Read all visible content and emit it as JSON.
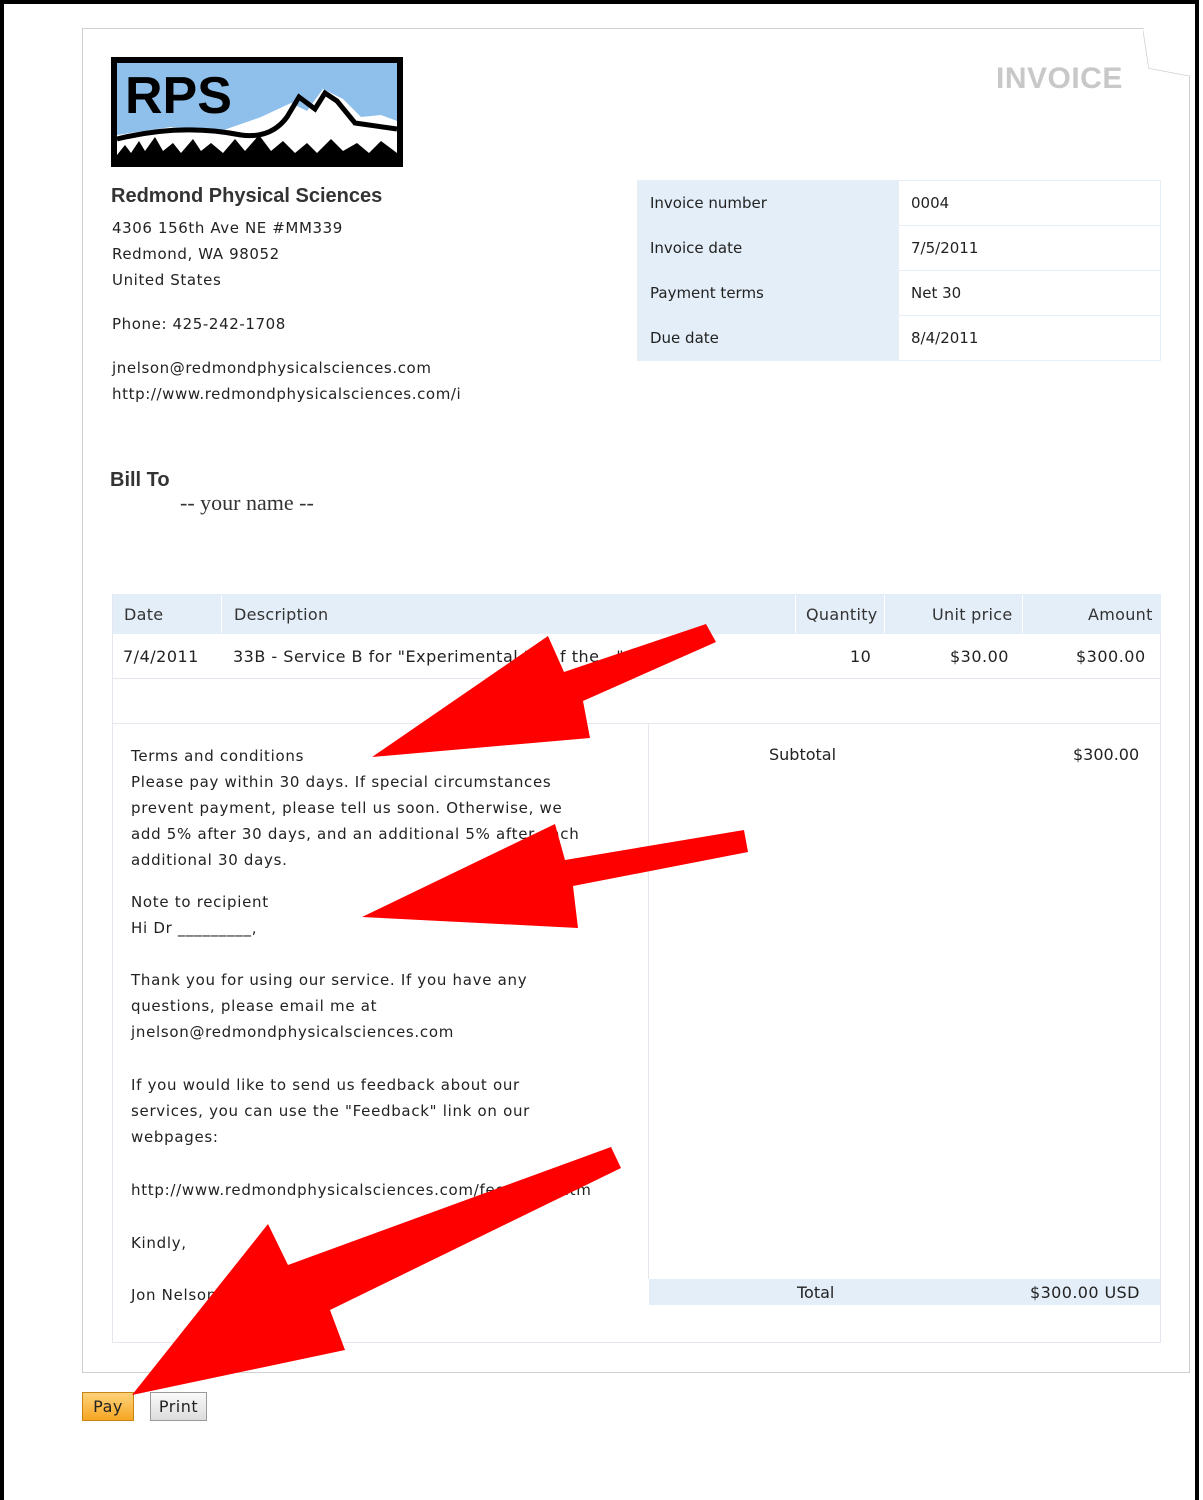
{
  "header": {
    "doc_title": "INVOICE"
  },
  "company": {
    "logo_text": "RPS",
    "name": "Redmond Physical Sciences",
    "address_line1": "4306 156th Ave NE #MM339",
    "address_line2": "Redmond, WA 98052",
    "country": "United States",
    "phone": "Phone: 425-242-1708",
    "email": "jnelson@redmondphysicalsciences.com",
    "website": "http://www.redmondphysicalsciences.com/i"
  },
  "meta": {
    "invoice_number_label": "Invoice number",
    "invoice_number": "0004",
    "invoice_date_label": "Invoice date",
    "invoice_date": "7/5/2011",
    "payment_terms_label": "Payment terms",
    "payment_terms": "Net 30",
    "due_date_label": "Due date",
    "due_date": "8/4/2011"
  },
  "bill_to": {
    "label": "Bill To",
    "name": "-- your name --"
  },
  "items": {
    "headers": {
      "date": "Date",
      "description": "Description",
      "quantity": "Quantity",
      "unit_price": "Unit price",
      "amount": "Amount"
    },
    "rows": [
      {
        "date": "7/4/2011",
        "description": "33B - Service B for \"Experimental t",
        "description_tail": "f the...\"",
        "quantity": "10",
        "unit_price": "$30.00",
        "amount": "$300.00"
      }
    ]
  },
  "terms": {
    "heading": "Terms and conditions",
    "lines": [
      "Please pay within 30 days. If special circumstances",
      "prevent payment, please tell us soon. Otherwise, we",
      "add 5% after 30 days, and an additional 5% after each",
      "additional 30 days."
    ],
    "note_heading": "Note to recipient",
    "note_greeting": "Hi Dr _________,",
    "thanks_lines": [
      "Thank you for using our service. If you have any",
      "questions, please email me at",
      "jnelson@redmondphysicalsciences.com"
    ],
    "feedback_lines": [
      "If you would like to send us feedback about our",
      "services, you can use the \"Feedback\" link on our",
      "webpages:"
    ],
    "feedback_url": "http://www.redmondphysicalsciences.com/feedback.htm",
    "closing": "Kindly,",
    "signature": "Jon Nelson"
  },
  "totals": {
    "subtotal_label": "Subtotal",
    "subtotal": "$300.00",
    "total_label": "Total",
    "total": "$300.00 USD"
  },
  "buttons": {
    "pay": "Pay",
    "print": "Print"
  },
  "colors": {
    "annotation_arrow": "#ff0000",
    "header_fill": "#e4eef8",
    "pay_button": "#f5a623"
  }
}
